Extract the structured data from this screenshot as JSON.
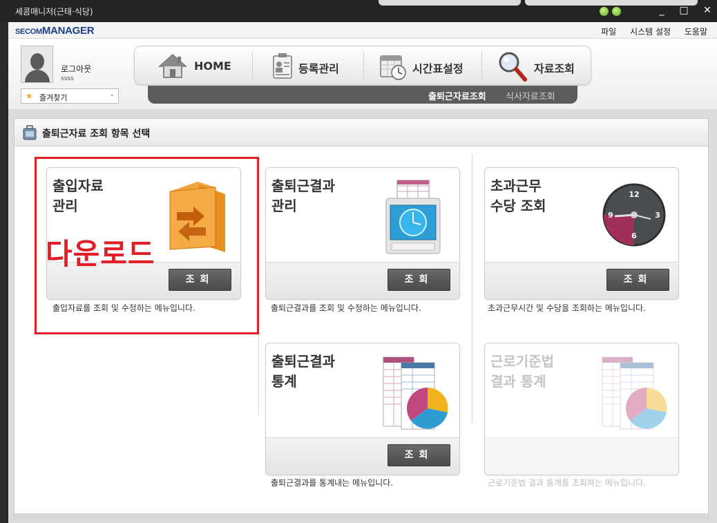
{
  "window": {
    "title": "세콤매니저(근태·식당)",
    "controls": [
      "_",
      "□",
      "✕"
    ]
  },
  "brand": {
    "logo_prefix": "SECOM",
    "logo_suffix": "MANAGER"
  },
  "menubar": {
    "items": [
      "파일",
      "시스템 설정",
      "도움말"
    ]
  },
  "user": {
    "logout_label": "로그아웃",
    "name": "ssss"
  },
  "favorites": {
    "label": "즐겨찾기",
    "star": "★",
    "chevron": "⌄"
  },
  "nav": {
    "items": [
      {
        "label": "HOME",
        "icon": "home-icon"
      },
      {
        "label": "등록관리",
        "icon": "id-card-icon"
      },
      {
        "label": "시간표설정",
        "icon": "calendar-clock-icon"
      },
      {
        "label": "자료조회",
        "icon": "magnifier-icon"
      }
    ],
    "sub_items": [
      "출퇴근자료조회",
      "식사자료조회"
    ]
  },
  "panel": {
    "title": "출퇴근자료 조회  항목 선택"
  },
  "cards": [
    {
      "title": "출입자료\n관리",
      "button": "조회",
      "description": "출입자료를 조회 및 수정하는 메뉴입니다.",
      "icon": "folder-transfer-icon",
      "enabled": true
    },
    {
      "title": "출퇴근결과\n관리",
      "button": "조회",
      "description": "출퇴근결과를 조회 및 수정하는 메뉴입니다.",
      "icon": "time-clock-icon",
      "enabled": true
    },
    {
      "title": "초과근무\n수당 조회",
      "button": "조회",
      "description": "초과근무시간 및 수당을 조회하는 메뉴입니다.",
      "icon": "wall-clock-icon",
      "enabled": true
    },
    {
      "title": "출퇴근결과\n통계",
      "button": "조회",
      "description": "출퇴근결과를 통계내는 메뉴입니다.",
      "icon": "report-pie-icon",
      "enabled": true
    },
    {
      "title": "근로기준법\n결과 통계",
      "button": "",
      "description": "근로기준법 결과 통계를 조회하는 메뉴입니다.",
      "icon": "report-pie-icon",
      "enabled": false
    }
  ],
  "clock_numbers": [
    "12",
    "3",
    "6",
    "9"
  ],
  "annotation": {
    "text": "다운로드",
    "color": "#e21f26"
  },
  "colors": {
    "accent_dark": "#5c5c5c",
    "brand_blue": "#1b3f86",
    "annotation_red": "#e21f26"
  }
}
